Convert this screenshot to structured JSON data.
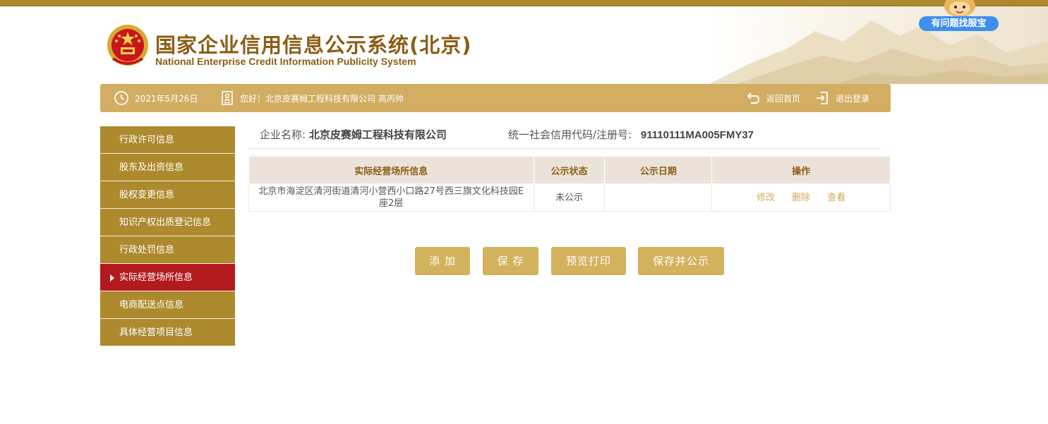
{
  "header": {
    "title_cn": "国家企业信用信息公示系统(北京)",
    "title_en": "National Enterprise Credit Information Publicity System",
    "help_label": "有问题找服宝"
  },
  "info_bar": {
    "date": "2021年5月26日",
    "greeting": "您好！北京皮赛姆工程科技有限公司 高丙帅",
    "home_label": "返回首页",
    "logout_label": "退出登录"
  },
  "sidebar": {
    "items": [
      {
        "label": "行政许可信息"
      },
      {
        "label": "股东及出资信息"
      },
      {
        "label": "股权变更信息"
      },
      {
        "label": "知识产权出质登记信息"
      },
      {
        "label": "行政处罚信息"
      },
      {
        "label": "实际经营场所信息",
        "active": true
      },
      {
        "label": "电商配送点信息"
      },
      {
        "label": "具体经营项目信息"
      }
    ]
  },
  "company": {
    "name_label": "企业名称:",
    "name": "北京皮赛姆工程科技有限公司",
    "code_label": "统一社会信用代码/注册号:",
    "code": "91110111MA005FMY37"
  },
  "table": {
    "headers": [
      "实际经营场所信息",
      "公示状态",
      "公示日期",
      "操作"
    ],
    "rows": [
      {
        "address_line1": "北京市海淀区清河街道清河小营西小口路27号西三旗文化科技园E",
        "address_line2": "座2层",
        "status": "未公示",
        "date": "",
        "ops": [
          "修改",
          "删除",
          "查看"
        ]
      }
    ]
  },
  "buttons": {
    "add": "添 加",
    "save": "保 存",
    "preview": "预览打印",
    "save_publish": "保存并公示"
  },
  "colors": {
    "gold": "#ad8a2e",
    "bar": "#d2ad62",
    "active": "#b31a1e",
    "button": "#d2b25c",
    "title": "#8b5e16",
    "help_blue": "#3f8ef0"
  }
}
